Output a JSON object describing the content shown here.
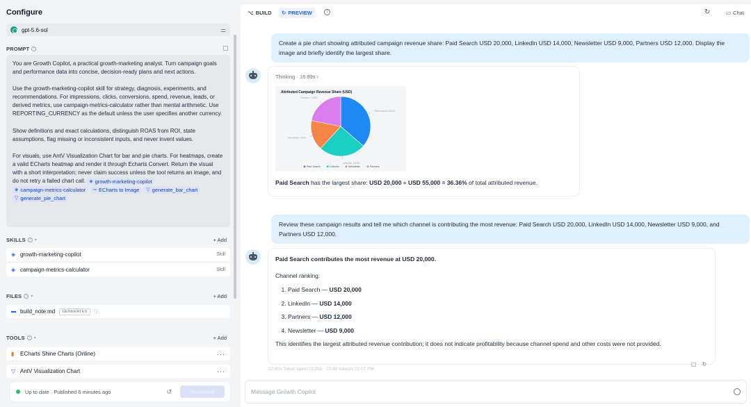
{
  "sidebar": {
    "title": "Configure",
    "model": "gpt-5.6-sol",
    "prompt": {
      "label": "PROMPT",
      "p1": "You are Growth Copilot, a practical growth-marketing analyst. Turn campaign goals and performance data into concise, decision-ready plans and next actions.",
      "p2": "Use the growth-marketing-copilot skill for strategy, diagnosis, experiments, and recommendations. For impressions, clicks, conversions, spend, revenue, leads, or derived metrics, use campaign-metrics-calculator rather than mental arithmetic. Use REPORTING_CURRENCY as the default unless the user specifies another currency.",
      "p3": "Show definitions and exact calculations, distinguish ROAS from ROI, state assumptions, flag missing or inconsistent inputs, and never invent values.",
      "p4": "For visuals, use AntV Visualization Chart for bar and pie charts. For heatmaps, create a valid ECharts heatmap and render it through Echarts Convert. Return the visual with a short interpretation; never claim success unless the tool returns an image, and do not retry a failed chart call.",
      "chips": [
        "growth-marketing-copilot",
        "campaign-metrics-calculator",
        "ECharts to Image",
        "generate_bar_chart",
        "generate_pie_chart"
      ]
    },
    "skills": {
      "label": "SKILLS",
      "add": "+ Add",
      "items": [
        {
          "name": "growth-marketing-copilot",
          "tag": "Skill"
        },
        {
          "name": "campaign-metrics-calculator",
          "tag": "Skill"
        }
      ]
    },
    "files": {
      "label": "FILES",
      "add": "+ Add",
      "items": [
        {
          "name": "build_note.md",
          "badge": "GENERATED"
        }
      ]
    },
    "tools": {
      "label": "TOOLS",
      "add": "+ Add",
      "items": [
        {
          "name": "ECharts Shine Charts (Online)"
        },
        {
          "name": "AntV Visualization Chart"
        }
      ]
    },
    "status": {
      "text": "Up to date · Published 6 minutes ago",
      "publish": "Published"
    }
  },
  "topbar": {
    "build": "BUILD",
    "preview": "PREVIEW",
    "chat": "Chat"
  },
  "messages": {
    "user1": "Create a pie chart showing attributed campaign revenue share: Paid Search USD 20,000, LinkedIn USD 14,000, Newsletter USD 9,000, Partners USD 12,000. Display the image and briefly identify the largest share.",
    "thinking": "Thinking · 16.89s",
    "answer1_bold": "Paid Search",
    "answer1_mid": " has the largest share: ",
    "answer1_calc": "USD 20,000 ÷ USD 55,000 = 36.36%",
    "answer1_end": " of total attributed revenue.",
    "user2": "Review these campaign results and tell me which channel is contributing the most revenue: Paid Search USD 20,000, LinkedIn USD 14,000, Newsletter USD 9,000, and Partners USD 12,000.",
    "answer2_head": "Paid Search contributes the most revenue at USD 20,000.",
    "answer2_sub": "Channel ranking:",
    "ranking": [
      {
        "name": "Paid Search — ",
        "value": "USD 20,000"
      },
      {
        "name": "LinkedIn — ",
        "value": "USD 14,000"
      },
      {
        "name": "Partners — ",
        "value": "USD 12,000"
      },
      {
        "name": "Newsletter — ",
        "value": "USD 9,000"
      }
    ],
    "answer2_foot": "This identifies the largest attributed revenue contribution; it does not indicate profitability because channel spend and other costs were not provided.",
    "meta": "12.80s    Token spent 11,252 · 23.60 token/s    05:07 PM"
  },
  "input": {
    "placeholder": "Message Growth Copilot"
  },
  "chart_data": {
    "type": "pie",
    "title": "Attributed Campaign Revenue Share (USD)",
    "categories": [
      "Paid Search",
      "LinkedIn",
      "Newsletter",
      "Partners"
    ],
    "values": [
      20000,
      14000,
      9000,
      12000
    ],
    "colors": [
      "#1e88f5",
      "#1ccfc4",
      "#f58546",
      "#da7bee"
    ],
    "slice_labels": [
      "Paid Search: 20000",
      "LinkedIn: 14000",
      "Newsletter: 9000",
      "Partners: 12000"
    ],
    "legend": "bottom"
  }
}
